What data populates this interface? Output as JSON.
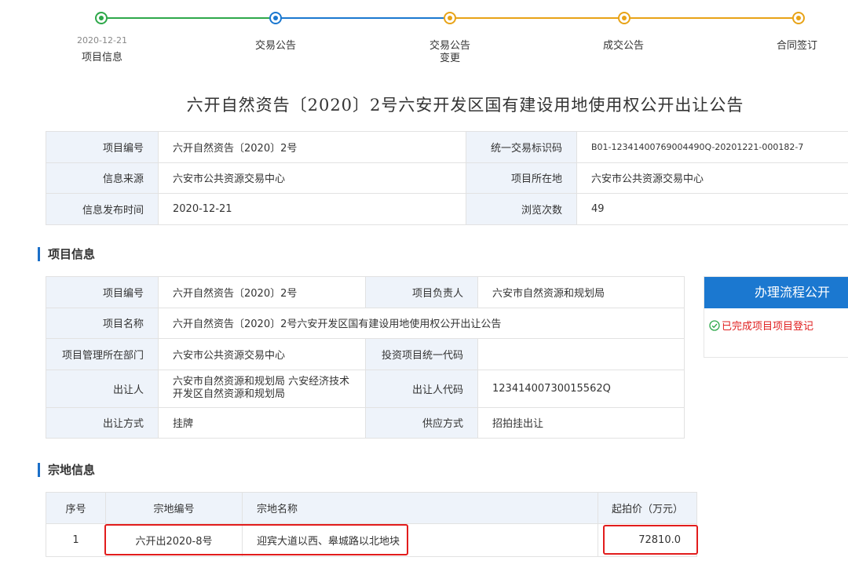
{
  "steps": [
    {
      "label": "项目信息",
      "date": "2020-12-21",
      "color": "#2ea84a"
    },
    {
      "label": "交易公告",
      "date": "",
      "color": "#1b78d0"
    },
    {
      "label": "交易公告变更",
      "date": "",
      "color": "#e8a317"
    },
    {
      "label": "成交公告",
      "date": "",
      "color": "#e8a317"
    },
    {
      "label": "合同签订",
      "date": "",
      "color": "#e8a317"
    }
  ],
  "title": "六开自然资告〔2020〕2号六安开发区国有建设用地使用权公开出让公告",
  "info": {
    "project_no_label": "项目编号",
    "project_no": "六开自然资告〔2020〕2号",
    "trade_id_label": "统一交易标识码",
    "trade_id": "B01-12341400769004490Q-20201221-000182-7",
    "source_label": "信息来源",
    "source": "六安市公共资源交易中心",
    "location_label": "项目所在地",
    "location": "六安市公共资源交易中心",
    "publish_time_label": "信息发布时间",
    "publish_time": "2020-12-21",
    "views_label": "浏览次数",
    "views": "49"
  },
  "project_section_title": "项目信息",
  "project": {
    "no_label": "项目编号",
    "no": "六开自然资告〔2020〕2号",
    "owner_label": "项目负责人",
    "owner": "六安市自然资源和规划局",
    "name_label": "项目名称",
    "name": "六开自然资告〔2020〕2号六安开发区国有建设用地使用权公开出让公告",
    "dept_label": "项目管理所在部门",
    "dept": "六安市公共资源交易中心",
    "invest_code_label": "投资项目统一代码",
    "invest_code": "",
    "seller_label": "出让人",
    "seller": "六安市自然资源和规划局 六安经济技术开发区自然资源和规划局",
    "seller_code_label": "出让人代码",
    "seller_code": "12341400730015562Q",
    "method_label": "出让方式",
    "method": "挂牌",
    "supply_label": "供应方式",
    "supply": "招拍挂出让"
  },
  "flow": {
    "header": "办理流程公开",
    "item": "已完成项目项目登记"
  },
  "lot_section_title": "宗地信息",
  "lots": {
    "headers": [
      "序号",
      "宗地编号",
      "宗地名称",
      "起拍价（万元）"
    ],
    "rows": [
      {
        "index": "1",
        "code": "六开出2020-8号",
        "name": "迎宾大道以西、皋城路以北地块",
        "price": "72810.0"
      }
    ]
  }
}
